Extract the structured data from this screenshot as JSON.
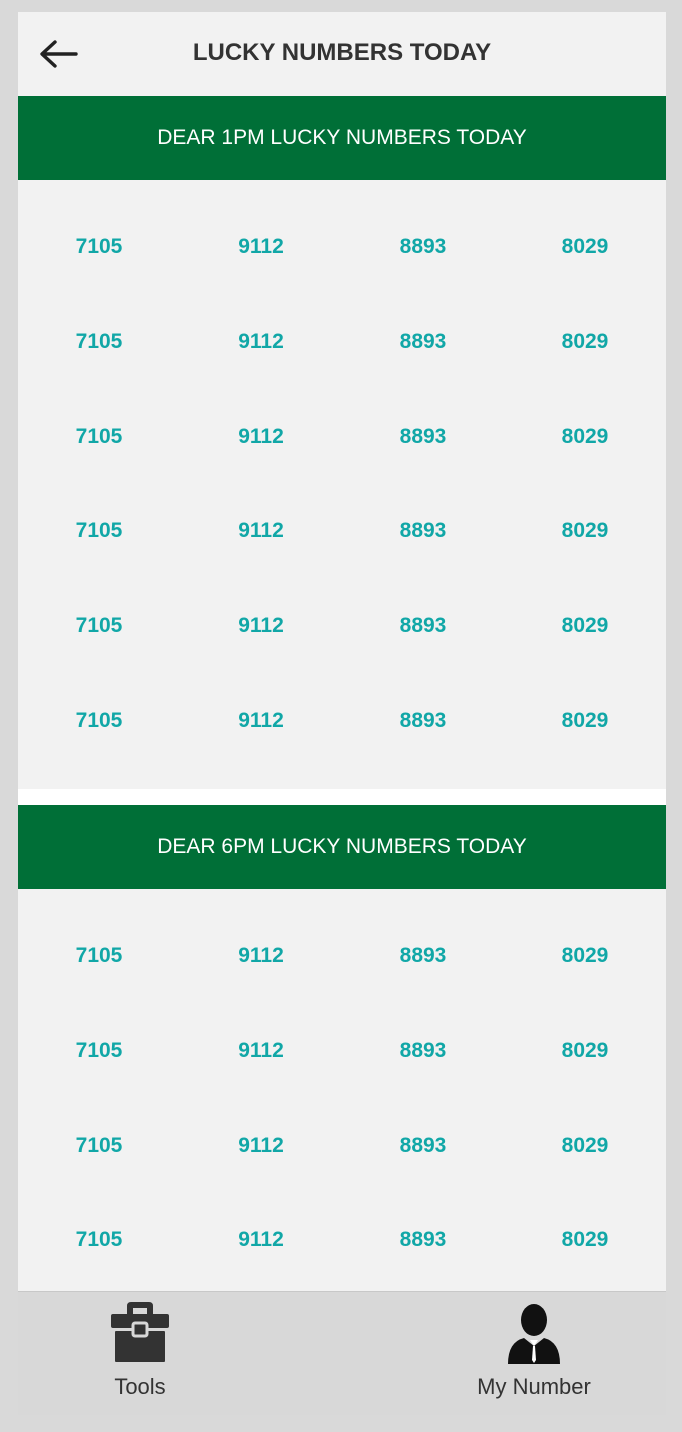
{
  "header": {
    "title": "LUCKY NUMBERS TODAY",
    "back_icon": "arrow-left-icon"
  },
  "sections": [
    {
      "title": "DEAR 1PM LUCKY NUMBERS TODAY",
      "rows": [
        [
          "7105",
          "9112",
          "8893",
          "8029"
        ],
        [
          "7105",
          "9112",
          "8893",
          "8029"
        ],
        [
          "7105",
          "9112",
          "8893",
          "8029"
        ],
        [
          "7105",
          "9112",
          "8893",
          "8029"
        ],
        [
          "7105",
          "9112",
          "8893",
          "8029"
        ],
        [
          "7105",
          "9112",
          "8893",
          "8029"
        ]
      ]
    },
    {
      "title": "DEAR 6PM LUCKY NUMBERS TODAY",
      "rows": [
        [
          "7105",
          "9112",
          "8893",
          "8029"
        ],
        [
          "7105",
          "9112",
          "8893",
          "8029"
        ],
        [
          "7105",
          "9112",
          "8893",
          "8029"
        ],
        [
          "7105",
          "9112",
          "8893",
          "8029"
        ]
      ]
    }
  ],
  "nav": {
    "tools_label": "Tools",
    "tools_icon": "toolbox-icon",
    "my_number_label": "My Number",
    "my_number_icon": "user-profile-icon"
  },
  "colors": {
    "header_green": "#006f37",
    "number_teal": "#11a7a7",
    "panel_bg": "#f2f2f2"
  }
}
